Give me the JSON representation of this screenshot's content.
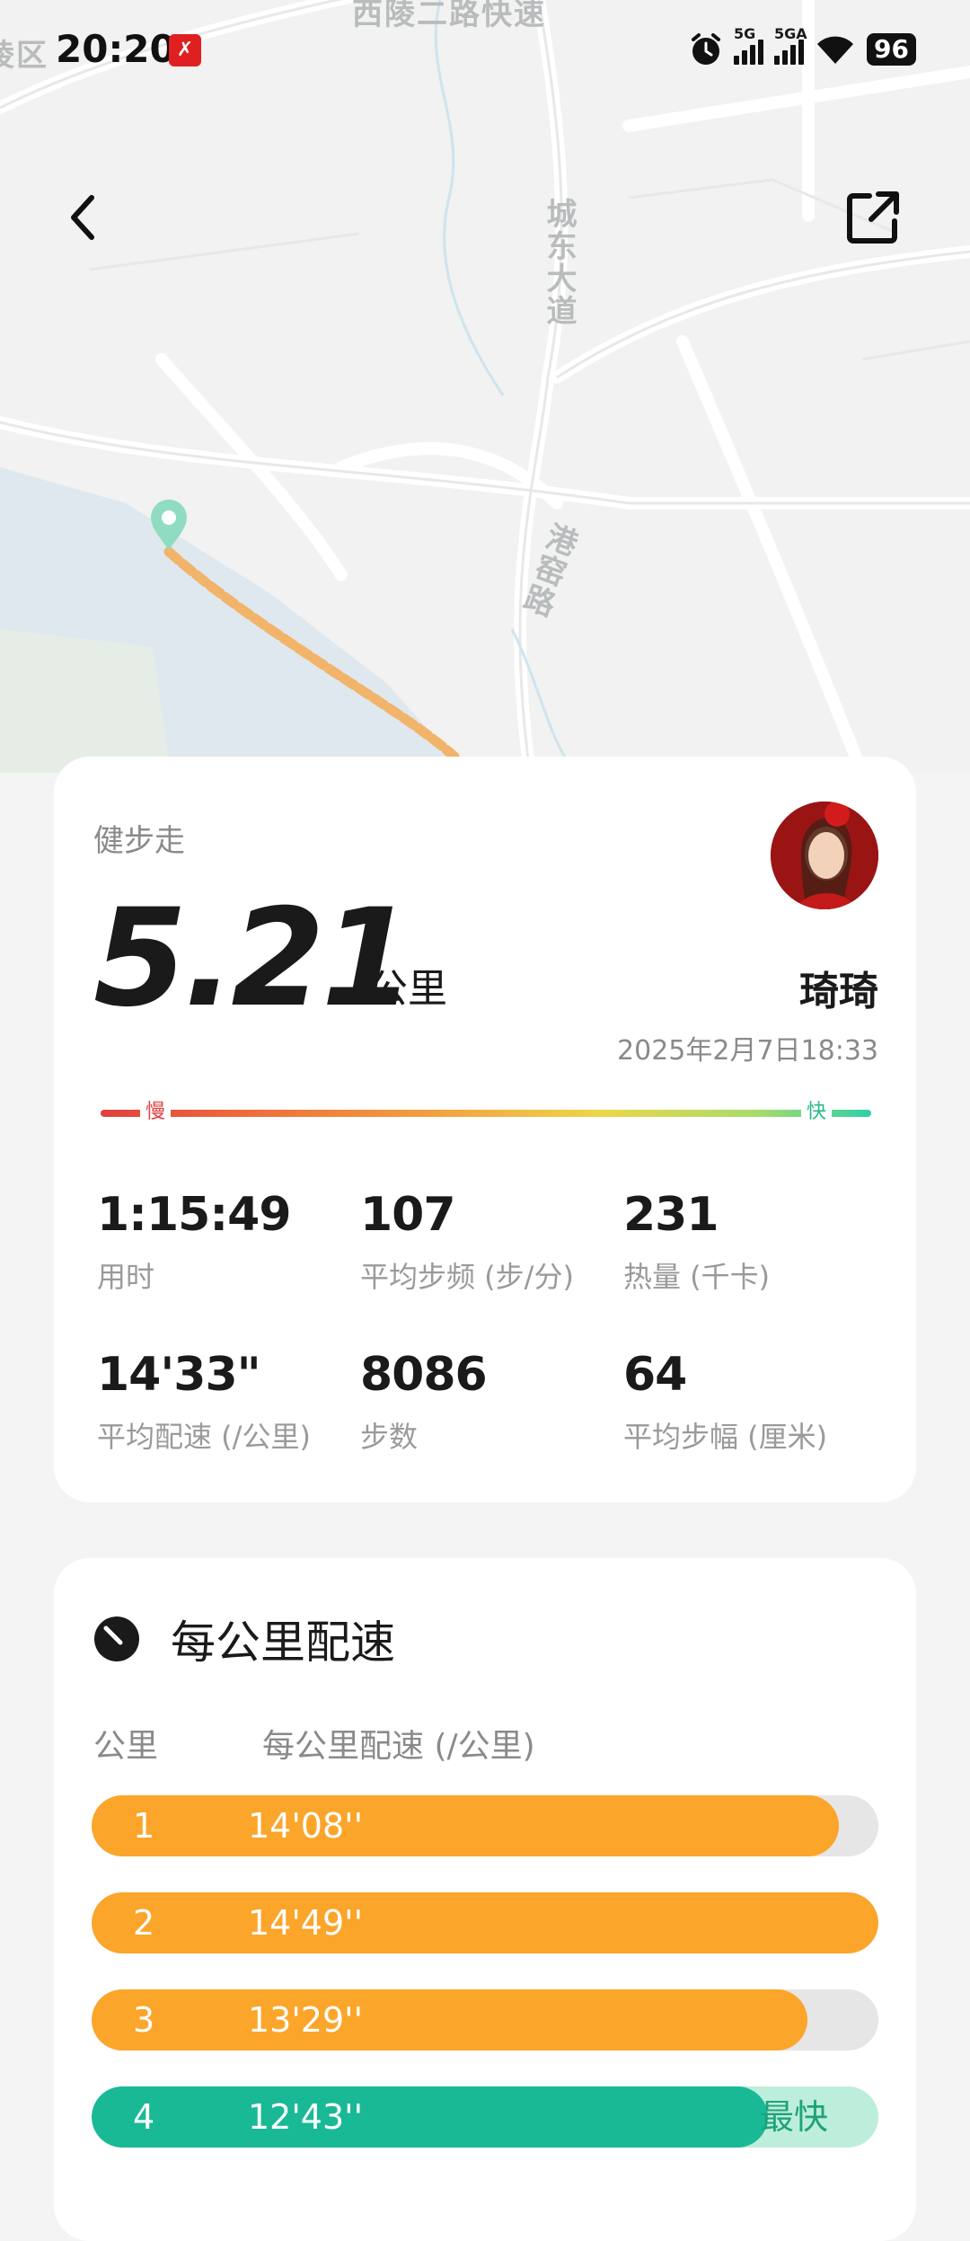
{
  "status_bar": {
    "time": "20:20",
    "app_badge": "✗",
    "network_1": "5G",
    "network_2": "5GA",
    "battery": "96"
  },
  "map": {
    "labels": {
      "road_top": "西陵二路快速",
      "road_city_east": "城东大道",
      "road_port": "港窑路",
      "district": "陵区"
    },
    "route_color": "#f2b46a",
    "start_marker_color": "#7ed8b8"
  },
  "summary": {
    "activity_type": "健步走",
    "distance": "5.21",
    "distance_unit": "公里",
    "user_name": "琦琦",
    "date": "2025年2月7日18:33",
    "speed_scale": {
      "slow": "慢",
      "fast": "快"
    },
    "stats": [
      {
        "value": "1:15:49",
        "label": "用时"
      },
      {
        "value": "107",
        "label": "平均步频 (步/分)"
      },
      {
        "value": "231",
        "label": "热量 (千卡)"
      },
      {
        "value": "14'33\"",
        "label": "平均配速 (/公里)"
      },
      {
        "value": "8086",
        "label": "步数"
      },
      {
        "value": "64",
        "label": "平均步幅 (厘米)"
      }
    ]
  },
  "pace": {
    "title": "每公里配速",
    "col_km": "公里",
    "col_pace": "每公里配速 (/公里)",
    "colors": {
      "normal": "#fba52a",
      "fastest": "#1ab996",
      "fastest_track": "#bdeedb"
    },
    "fastest_badge": "最快",
    "rows": [
      {
        "km": "1",
        "pace": "14'08''",
        "fill": 0.95,
        "fastest": false
      },
      {
        "km": "2",
        "pace": "14'49''",
        "fill": 1.0,
        "fastest": false
      },
      {
        "km": "3",
        "pace": "13'29''",
        "fill": 0.91,
        "fastest": false
      },
      {
        "km": "4",
        "pace": "12'43''",
        "fill": 0.86,
        "fastest": true
      }
    ]
  }
}
